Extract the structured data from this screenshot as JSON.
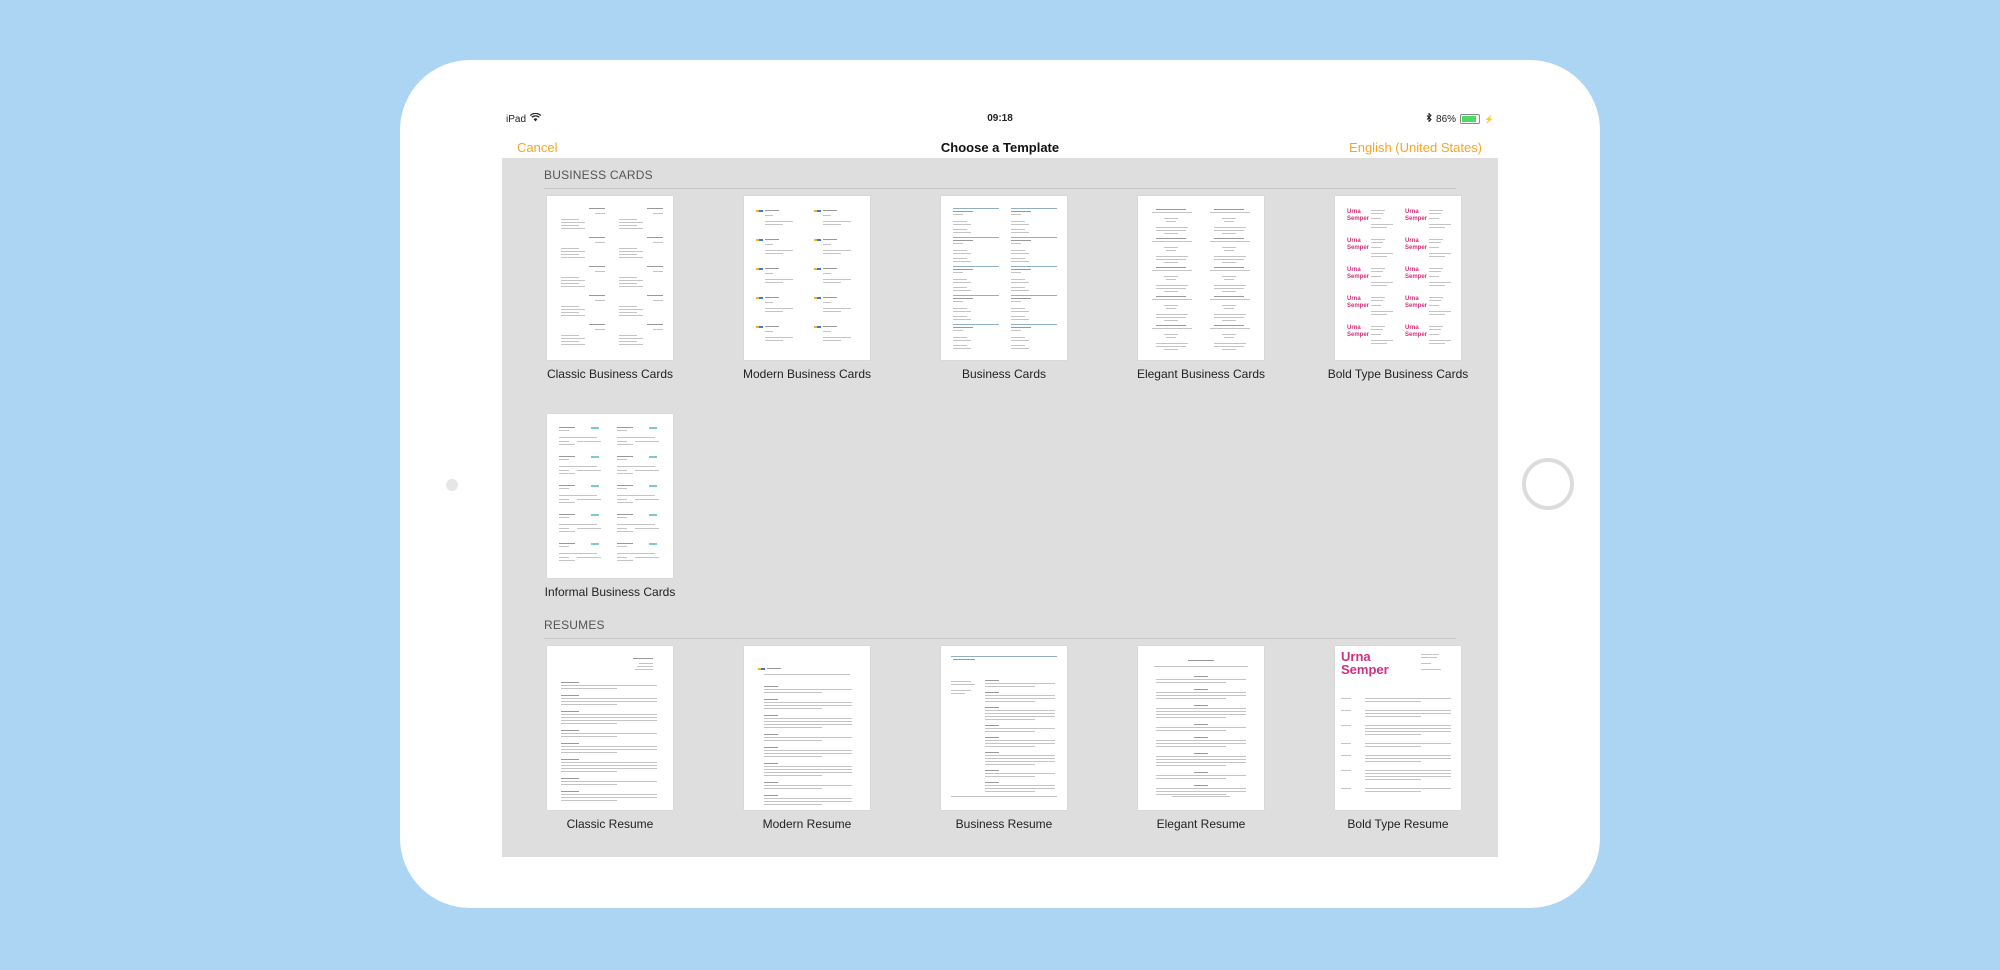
{
  "status_bar": {
    "device": "iPad",
    "wifi_icon": "wifi-icon",
    "time": "09:18",
    "bluetooth_icon": "bluetooth-icon",
    "battery_percent": "86%",
    "battery_level": 0.86,
    "charging_icon": "charging-icon"
  },
  "nav": {
    "cancel_label": "Cancel",
    "title": "Choose a Template",
    "language_label": "English (United States)"
  },
  "colors": {
    "accent": "#f5a623",
    "background": "#acd5f4",
    "content_bg": "#dedede",
    "bold_type_pink": "#d0307f"
  },
  "sections": [
    {
      "title": "BUSINESS CARDS",
      "templates": [
        {
          "label": "Classic Business Cards"
        },
        {
          "label": "Modern Business Cards"
        },
        {
          "label": "Business Cards"
        },
        {
          "label": "Elegant Business Cards"
        },
        {
          "label": "Bold Type Business Cards",
          "preview_text": "Urna Semper"
        },
        {
          "label": "Informal Business Cards"
        }
      ]
    },
    {
      "title": "RESUMES",
      "templates": [
        {
          "label": "Classic Resume"
        },
        {
          "label": "Modern Resume"
        },
        {
          "label": "Business Resume"
        },
        {
          "label": "Elegant Resume"
        },
        {
          "label": "Bold Type Resume",
          "preview_text_line1": "Urna",
          "preview_text_line2": "Semper"
        }
      ]
    }
  ]
}
